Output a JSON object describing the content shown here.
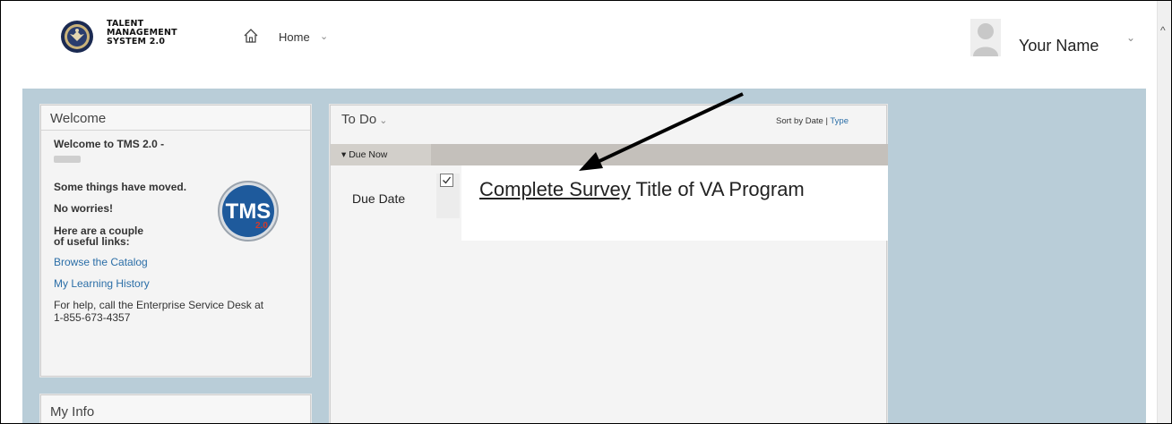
{
  "header": {
    "logo_text": [
      "TALENT",
      "MANAGEMENT",
      "SYSTEM 2.0"
    ],
    "home_label": "Home",
    "home_chevron": "⌄",
    "user_name": "Your Name",
    "user_chevron": "⌄"
  },
  "icons": {
    "home": "home-icon",
    "avatar": "user-avatar-icon",
    "checkbox": "checkmark-icon",
    "seal": "va-seal-icon"
  },
  "welcome": {
    "title": "Welcome",
    "heading": "Welcome to TMS 2.0 -",
    "line1": "Some things have moved.",
    "line2": "No worries!",
    "line3a": "Here are a couple",
    "line3b": "of useful links:",
    "link1": "Browse the Catalog",
    "link2": "My Learning History",
    "help_a": "For help, call the Enterprise Service Desk at",
    "help_b": "1-855-673-4357",
    "tms_logo_text": "TMS",
    "tms_logo_sub": "2.0"
  },
  "my_info": {
    "title": "My Info"
  },
  "todo": {
    "title": "To Do",
    "chevron": "⌄",
    "sort_prefix": "Sort by Date | ",
    "sort_type": "Type",
    "group_label": "▾ Due Now",
    "due_date_label": "Due Date",
    "item_link": "Complete Survey",
    "item_title": " Title of VA Program"
  },
  "colors": {
    "page_bg": "#b9cdd8",
    "link": "#2b6ea7",
    "group_header": "#c4c0bb",
    "tms_blue": "#1e5a9c",
    "tms_red": "#d23a2a"
  }
}
